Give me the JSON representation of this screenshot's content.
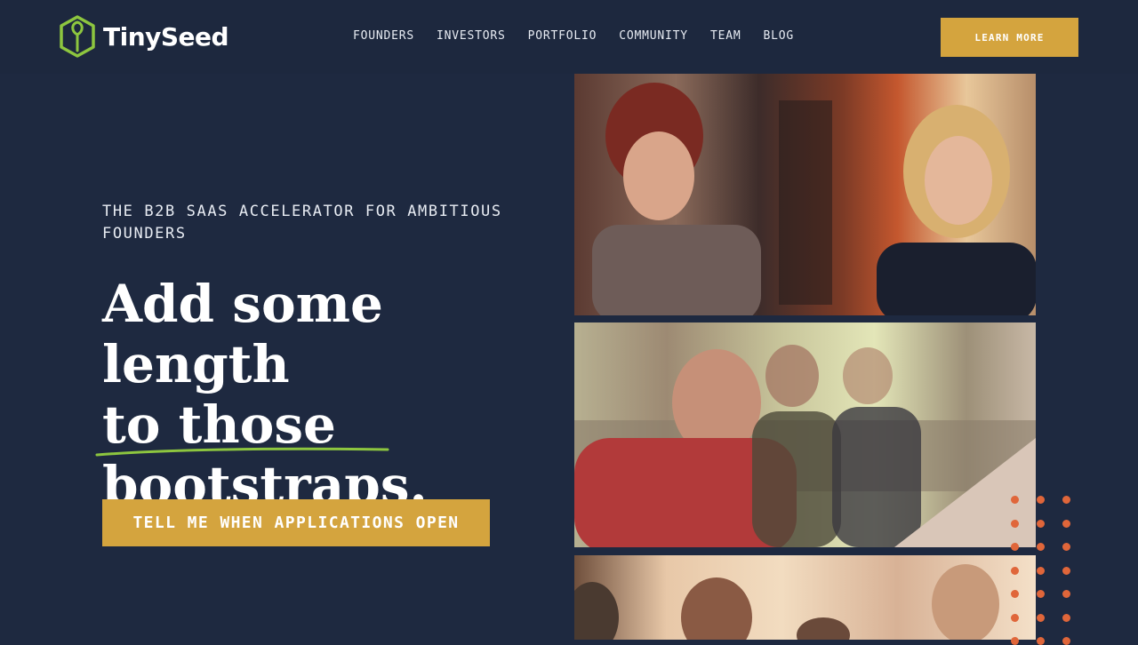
{
  "brand": {
    "name": "TinySeed"
  },
  "nav": {
    "items": [
      {
        "label": "FOUNDERS"
      },
      {
        "label": "INVESTORS"
      },
      {
        "label": "PORTFOLIO"
      },
      {
        "label": "COMMUNITY"
      },
      {
        "label": "TEAM"
      },
      {
        "label": "BLOG"
      }
    ],
    "cta_label": "LEARN MORE"
  },
  "hero": {
    "eyebrow": "THE B2B SAAS ACCELERATOR FOR AMBITIOUS FOUNDERS",
    "headline_line1": "Add some length",
    "headline_line2": "to those",
    "headline_bold": "bootstraps",
    "headline_period": ".",
    "cta_label": "TELL ME WHEN APPLICATIONS OPEN"
  },
  "colors": {
    "background": "#1e2940",
    "accent": "#d4a43e",
    "logo_green": "#8dc63f",
    "dots": "#e0663a"
  }
}
